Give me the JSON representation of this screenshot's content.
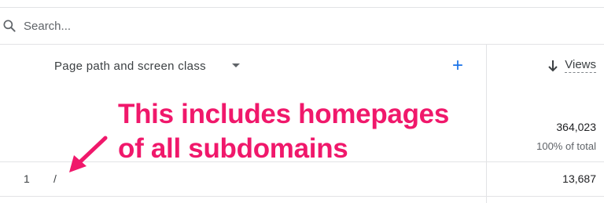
{
  "search": {
    "placeholder": "Search..."
  },
  "table": {
    "dimension_header": "Page path and screen class",
    "add_dimension_symbol": "+",
    "metric_header": "Views",
    "metric_total": "364,023",
    "metric_total_percent": "100% of total",
    "rows": [
      {
        "index": "1",
        "path": "/",
        "views": "13,687"
      }
    ]
  },
  "annotation": {
    "line1": "This includes homepages",
    "line2": "of all subdomains",
    "color": "#f0186b"
  },
  "colors": {
    "accent": "#1a73e8",
    "divider": "#e2e3e5"
  },
  "icons": {
    "search": "search-icon",
    "sort": "arrow-down-icon",
    "dropdown": "caret-down-icon",
    "add": "plus-icon"
  }
}
